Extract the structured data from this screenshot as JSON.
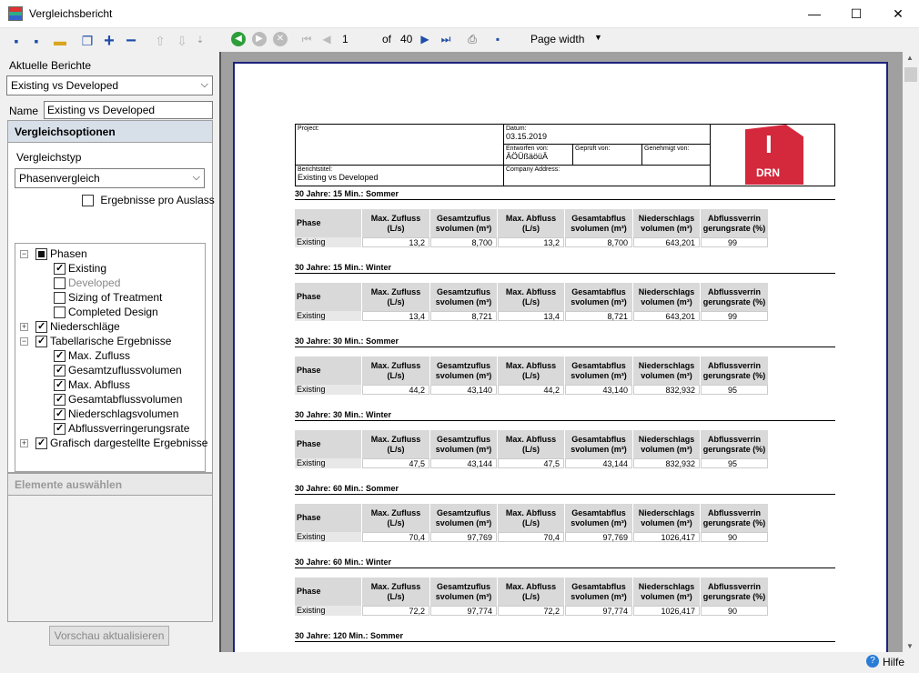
{
  "window": {
    "title": "Vergleichsbericht",
    "min": "—",
    "max": "☐",
    "close": "✕"
  },
  "left": {
    "current_reports_label": "Aktuelle Berichte",
    "current_report": "Existing vs Developed",
    "name_label": "Name",
    "name_value": "Existing vs Developed",
    "options_header": "Vergleichsoptionen",
    "compare_type_label": "Vergleichstyp",
    "compare_type": "Phasenvergleich",
    "per_outlet_label": "Ergebnisse pro Auslass",
    "tree": [
      {
        "label": "Phasen",
        "state": "part",
        "exp": "−"
      },
      {
        "label": "Existing",
        "state": "on"
      },
      {
        "label": "Developed",
        "state": "off",
        "disabled": true
      },
      {
        "label": "Sizing of Treatment",
        "state": "off"
      },
      {
        "label": "Completed Design",
        "state": "off"
      },
      {
        "label": "Niederschläge",
        "state": "on",
        "exp": "+"
      },
      {
        "label": "Tabellarische Ergebnisse",
        "state": "on",
        "exp": "−"
      },
      {
        "label": "Max. Zufluss",
        "state": "on"
      },
      {
        "label": "Gesamtzuflussvolumen",
        "state": "on"
      },
      {
        "label": "Max. Abfluss",
        "state": "on"
      },
      {
        "label": "Gesamtabflussvolumen",
        "state": "on"
      },
      {
        "label": "Niederschlagsvolumen",
        "state": "on"
      },
      {
        "label": "Abflussverringerungsrate",
        "state": "on"
      },
      {
        "label": "Grafisch dargestellte Ergebnisse",
        "state": "on",
        "exp": "+"
      }
    ],
    "select_elements_header": "Elemente auswählen",
    "refresh_button": "Vorschau aktualisieren"
  },
  "viewer": {
    "page": "1",
    "of": "of",
    "total": "40",
    "zoom": "Page width",
    "report": {
      "project_label": "Project:",
      "date_label": "Datum:",
      "date": "03.15.2019",
      "designed_label": "Entworfen von:",
      "designed": "ÄÖÜßäöüÄ",
      "checked_label": "Geprüft von:",
      "approved_label": "Genehmigt von:",
      "company_label": "Company Address:",
      "title_label": "Berichtstitel:",
      "title": "Existing vs Developed",
      "logo_letter": "I",
      "logo_text": "DRN",
      "headers": [
        "Phase",
        "Max. Zufluss (L/s)",
        "Gesamtzuflus svolumen (m³)",
        "Max. Abfluss (L/s)",
        "Gesamtabflus svolumen (m³)",
        "Niederschlags volumen (m³)",
        "Abflussverrin gerungsrate (%)"
      ],
      "blocks": [
        {
          "title": "30 Jahre: 15 Min.: Sommer",
          "row": [
            "Existing",
            "13,2",
            "8,700",
            "13,2",
            "8,700",
            "643,201",
            "99"
          ]
        },
        {
          "title": "30 Jahre: 15 Min.: Winter",
          "row": [
            "Existing",
            "13,4",
            "8,721",
            "13,4",
            "8,721",
            "643,201",
            "99"
          ]
        },
        {
          "title": "30 Jahre: 30 Min.: Sommer",
          "row": [
            "Existing",
            "44,2",
            "43,140",
            "44,2",
            "43,140",
            "832,932",
            "95"
          ]
        },
        {
          "title": "30 Jahre: 30 Min.: Winter",
          "row": [
            "Existing",
            "47,5",
            "43,144",
            "47,5",
            "43,144",
            "832,932",
            "95"
          ]
        },
        {
          "title": "30 Jahre: 60 Min.: Sommer",
          "row": [
            "Existing",
            "70,4",
            "97,769",
            "70,4",
            "97,769",
            "1026,417",
            "90"
          ]
        },
        {
          "title": "30 Jahre: 60 Min.: Winter",
          "row": [
            "Existing",
            "72,2",
            "97,774",
            "72,2",
            "97,774",
            "1026,417",
            "90"
          ]
        },
        {
          "title": "30 Jahre: 120 Min.: Sommer",
          "row": []
        }
      ]
    }
  },
  "status": {
    "help": "Hilfe"
  }
}
